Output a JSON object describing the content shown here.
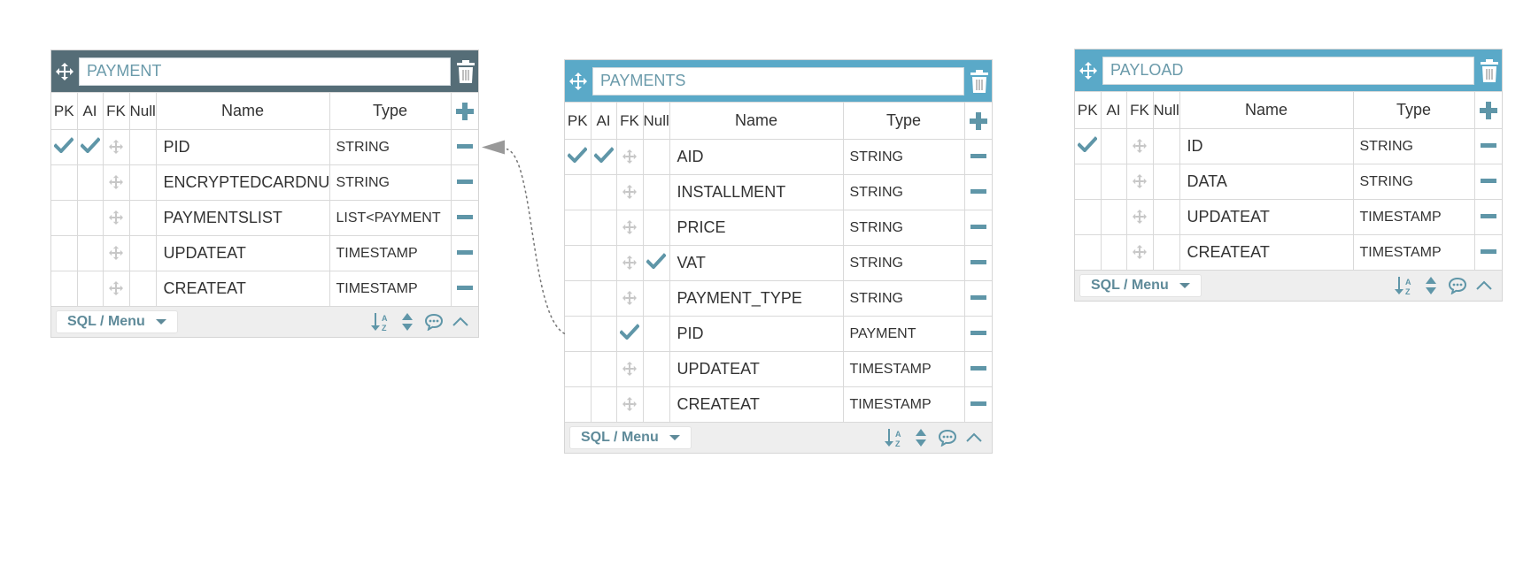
{
  "colors": {
    "header_payment": "#556d77",
    "header_default": "#5aa9c8",
    "accent": "#5f96a8",
    "fk_faded": "#c7c7c7"
  },
  "footer": {
    "sql_menu_label": "SQL / Menu"
  },
  "tables": [
    {
      "id": "payment",
      "name": "PAYMENT",
      "columns_header": {
        "pk": "PK",
        "ai": "AI",
        "fk": "FK",
        "null": "Null",
        "name": "Name",
        "type": "Type"
      },
      "fields": [
        {
          "pk": true,
          "ai": true,
          "fk": false,
          "null": false,
          "name": "PID",
          "type": "STRING"
        },
        {
          "pk": false,
          "ai": false,
          "fk": false,
          "null": false,
          "name": "ENCRYPTEDCARDNU",
          "type": "STRING"
        },
        {
          "pk": false,
          "ai": false,
          "fk": false,
          "null": false,
          "name": "PAYMENTSLIST",
          "type": "LIST<PAYMENT"
        },
        {
          "pk": false,
          "ai": false,
          "fk": false,
          "null": false,
          "name": "UPDATEAT",
          "type": "TIMESTAMP"
        },
        {
          "pk": false,
          "ai": false,
          "fk": false,
          "null": false,
          "name": "CREATEAT",
          "type": "TIMESTAMP"
        }
      ]
    },
    {
      "id": "payments",
      "name": "PAYMENTS",
      "columns_header": {
        "pk": "PK",
        "ai": "AI",
        "fk": "FK",
        "null": "Null",
        "name": "Name",
        "type": "Type"
      },
      "fields": [
        {
          "pk": true,
          "ai": true,
          "fk": false,
          "null": false,
          "name": "AID",
          "type": "STRING"
        },
        {
          "pk": false,
          "ai": false,
          "fk": false,
          "null": false,
          "name": "INSTALLMENT",
          "type": "STRING"
        },
        {
          "pk": false,
          "ai": false,
          "fk": false,
          "null": false,
          "name": "PRICE",
          "type": "STRING"
        },
        {
          "pk": false,
          "ai": false,
          "fk": false,
          "null": true,
          "name": "VAT",
          "type": "STRING"
        },
        {
          "pk": false,
          "ai": false,
          "fk": false,
          "null": false,
          "name": "PAYMENT_TYPE",
          "type": "STRING"
        },
        {
          "pk": false,
          "ai": false,
          "fk": true,
          "null": false,
          "name": "PID",
          "type": "PAYMENT"
        },
        {
          "pk": false,
          "ai": false,
          "fk": false,
          "null": false,
          "name": "UPDATEAT",
          "type": "TIMESTAMP"
        },
        {
          "pk": false,
          "ai": false,
          "fk": false,
          "null": false,
          "name": "CREATEAT",
          "type": "TIMESTAMP"
        }
      ]
    },
    {
      "id": "payload",
      "name": "PAYLOAD",
      "columns_header": {
        "pk": "PK",
        "ai": "AI",
        "fk": "FK",
        "null": "Null",
        "name": "Name",
        "type": "Type"
      },
      "fields": [
        {
          "pk": true,
          "ai": false,
          "fk": false,
          "null": false,
          "name": "ID",
          "type": "STRING"
        },
        {
          "pk": false,
          "ai": false,
          "fk": false,
          "null": false,
          "name": "DATA",
          "type": "STRING"
        },
        {
          "pk": false,
          "ai": false,
          "fk": false,
          "null": false,
          "name": "UPDATEAT",
          "type": "TIMESTAMP"
        },
        {
          "pk": false,
          "ai": false,
          "fk": false,
          "null": false,
          "name": "CREATEAT",
          "type": "TIMESTAMP"
        }
      ]
    }
  ],
  "relations": [
    {
      "from_table": "payments",
      "from_field": "PID",
      "to_table": "payment",
      "to_field": "PID"
    }
  ]
}
